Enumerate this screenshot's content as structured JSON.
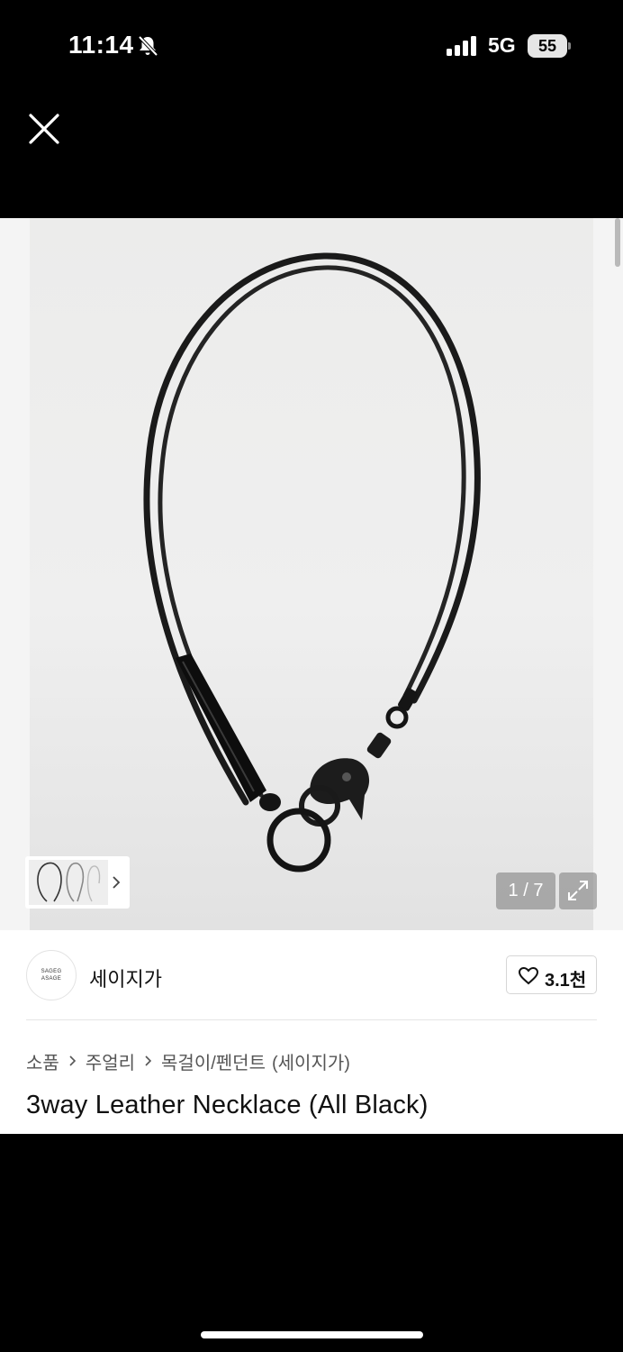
{
  "status_bar": {
    "time": "11:14",
    "network": "5G",
    "battery": "55",
    "icons": [
      "bell-off-icon",
      "signal-icon",
      "battery-icon"
    ]
  },
  "top_nav": {
    "close_icon": "close-icon"
  },
  "gallery": {
    "counter": "1 / 7",
    "expand_icon": "expand-icon",
    "thumb_chevron_icon": "chevron-right-icon"
  },
  "brand": {
    "logo_text_line1": "SAGEG",
    "logo_text_line2": "ASAGE",
    "name": "세이지가"
  },
  "like": {
    "icon": "heart-icon",
    "count": "3.1천"
  },
  "breadcrumb": {
    "items": [
      "소품",
      "주얼리",
      "목걸이/펜던트"
    ],
    "brand": "(세이지가)"
  },
  "product": {
    "title": "3way Leather Necklace (All Black)"
  },
  "colors": {
    "background": "#000000",
    "card": "#ffffff",
    "counter_bg": "#8a8a8a",
    "text_primary": "#111111",
    "text_secondary": "#555555"
  }
}
